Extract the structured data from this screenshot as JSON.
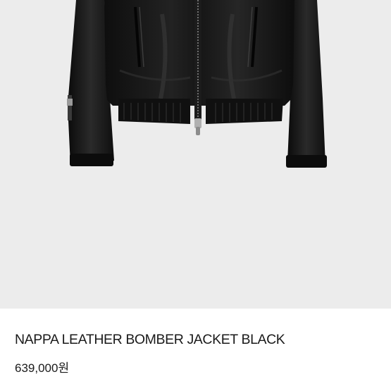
{
  "product": {
    "name": "NAPPA LEATHER BOMBER JACKET BLACK",
    "price": "639,000원"
  },
  "colors": {
    "image_background": "#ececec",
    "jacket": "#141414",
    "text": "#1a1a1a"
  },
  "image": {
    "subject": "black leather bomber jacket (lower half)"
  }
}
